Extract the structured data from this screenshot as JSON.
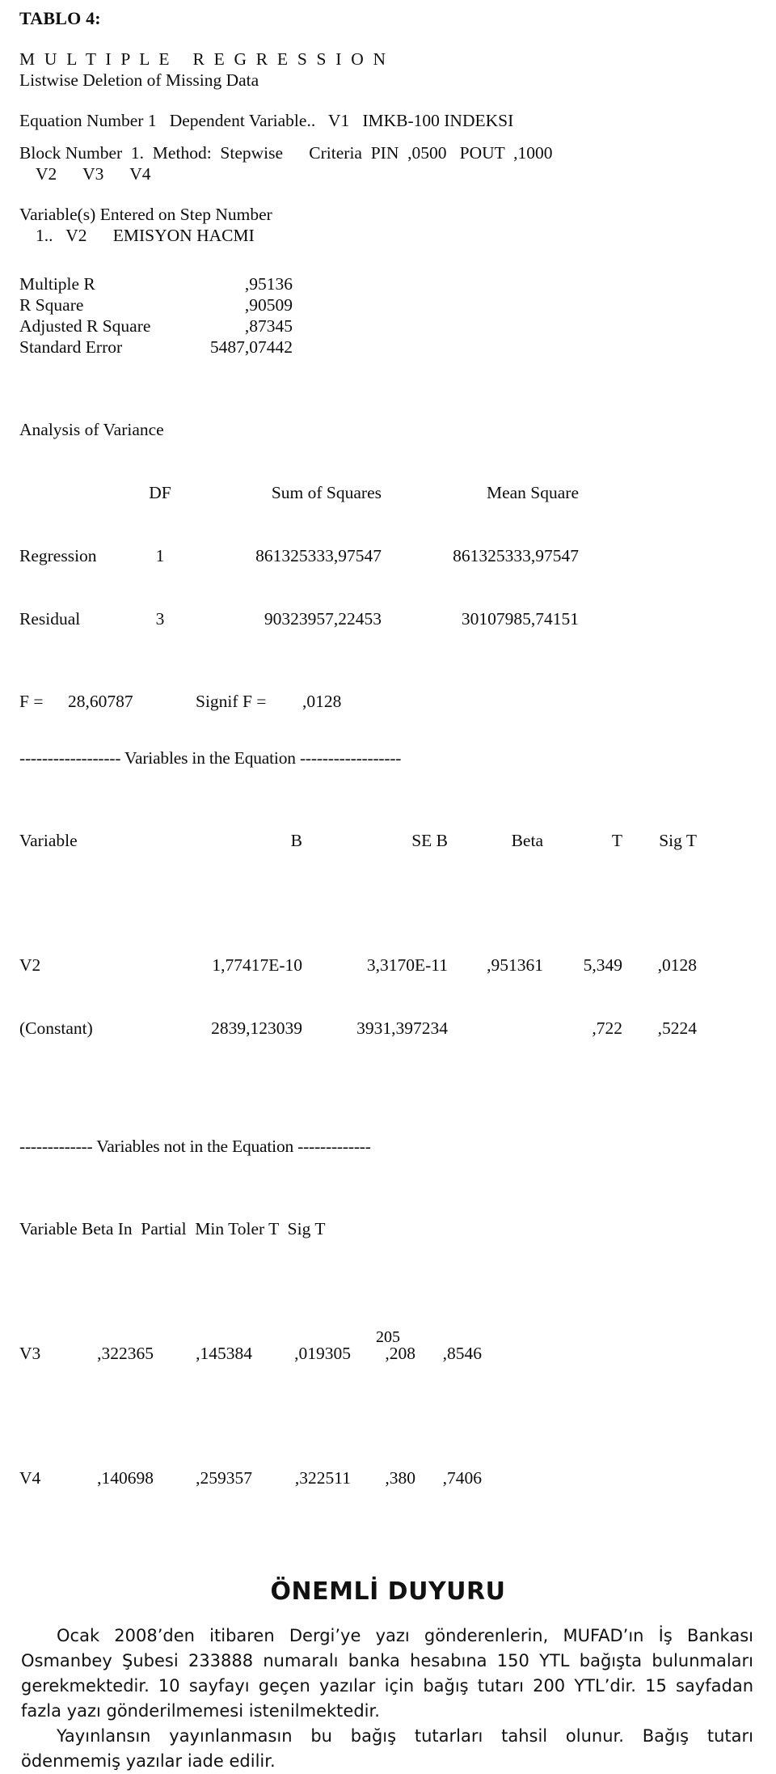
{
  "document": {
    "tablo_title": "TABLO 4:",
    "procedure_title": "M U L T I P L E   R E G R E S S I O N",
    "deletion_note": "Listwise Deletion of Missing Data",
    "equation_line": "Equation Number 1   Dependent Variable..   V1   IMKB-100 INDEKSI",
    "block_line": "Block Number  1.  Method:  Stepwise      Criteria  PIN  ,0500   POUT  ,1000",
    "block_vars": "V2      V3      V4",
    "entered_header": "Variable(s) Entered on Step Number",
    "entered_step": "1..   V2      EMISYON HACMI",
    "page_number": "205"
  },
  "summary": {
    "rows": [
      {
        "label": "Multiple R",
        "value": ",95136"
      },
      {
        "label": "R Square",
        "value": ",90509"
      },
      {
        "label": "Adjusted R Square",
        "value": ",87345"
      },
      {
        "label": "Standard Error",
        "value": "5487,07442"
      }
    ]
  },
  "anova": {
    "title": "Analysis of Variance",
    "headers": {
      "source": "",
      "df": "DF",
      "ss": "Sum of Squares",
      "ms": "Mean Square"
    },
    "rows": [
      {
        "source": "Regression",
        "df": "1",
        "ss": "861325333,97547",
        "ms": "861325333,97547"
      },
      {
        "source": "Residual",
        "df": "3",
        "ss": "90323957,22453",
        "ms": "30107985,74151"
      }
    ],
    "f_label": "F =",
    "f_value": "28,60787",
    "signif_label": "Signif F =",
    "signif_value": ",0128"
  },
  "vars_in_equation": {
    "separator": "------------------ Variables in the Equation ------------------",
    "headers": {
      "variable": "Variable",
      "b": "B",
      "se_b": "SE B",
      "beta": "Beta",
      "t": "T",
      "sig_t": "Sig T"
    },
    "rows": [
      {
        "variable": "V2",
        "b": "1,77417E-10",
        "se_b": "3,3170E-11",
        "beta": ",951361",
        "t": "5,349",
        "sig_t": ",0128"
      },
      {
        "variable": "(Constant)",
        "b": "2839,123039",
        "se_b": "3931,397234",
        "beta": "",
        "t": ",722",
        "sig_t": ",5224"
      }
    ]
  },
  "vars_not_in_equation": {
    "separator": "------------- Variables not in the Equation -------------",
    "headers_line": "Variable Beta In  Partial  Min Toler T  Sig T",
    "headers": {
      "variable": "Variable",
      "beta_in": "Beta In",
      "partial": "Partial",
      "min_toler": "Min Toler",
      "t": "T",
      "sig_t": "Sig T"
    },
    "rows": [
      {
        "variable": "V3",
        "beta_in": ",322365",
        "partial": ",145384",
        "min_toler": ",019305",
        "t": ",208",
        "sig_t": ",8546"
      },
      {
        "variable": "V4",
        "beta_in": ",140698",
        "partial": ",259357",
        "min_toler": ",322511",
        "t": ",380",
        "sig_t": ",7406"
      }
    ]
  },
  "notice": {
    "title": "ÖNEMLİ DUYURU",
    "paragraph_1": "Ocak 2008’den itibaren Dergi’ye yazı gönderenlerin, MUFAD’ın İş Bankası Osmanbey Şubesi 233888 numaralı banka hesabına 150 YTL bağışta bulunmaları gerekmektedir. 10 sayfayı geçen yazılar için bağış tutarı 200 YTL’dir. 15 sayfadan fazla yazı gönderilmemesi istenilmektedir.",
    "paragraph_2": "Yayınlansın yayınlanmasın bu bağış tutarları tahsil olunur. Bağış tutarı ödenmemiş yazılar iade edilir."
  }
}
